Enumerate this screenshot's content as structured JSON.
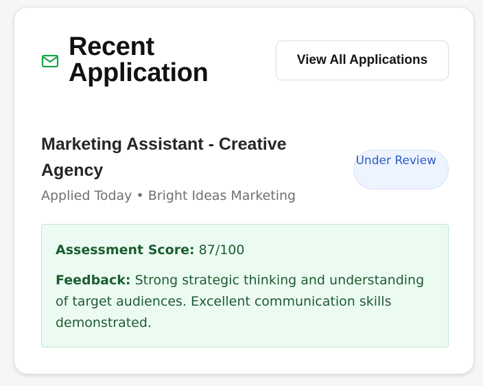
{
  "header": {
    "title": "Recent Application",
    "icon": "mail-icon",
    "view_all_label": "View All Applications"
  },
  "application": {
    "job_title": "Marketing Assistant - Creative Agency",
    "applied": "Applied Today",
    "separator": "•",
    "company": "Bright Ideas Marketing",
    "status": "Under Review",
    "assessment": {
      "score_label": "Assessment Score:",
      "score": "87/100",
      "feedback_label": "Feedback:",
      "feedback": "Strong strategic thinking and understanding of target audiences. Excellent communication skills demonstrated."
    }
  },
  "colors": {
    "accent_green": "#16a34a",
    "status_blue": "#2e5cc2",
    "assessment_bg": "#ecfbf1"
  }
}
